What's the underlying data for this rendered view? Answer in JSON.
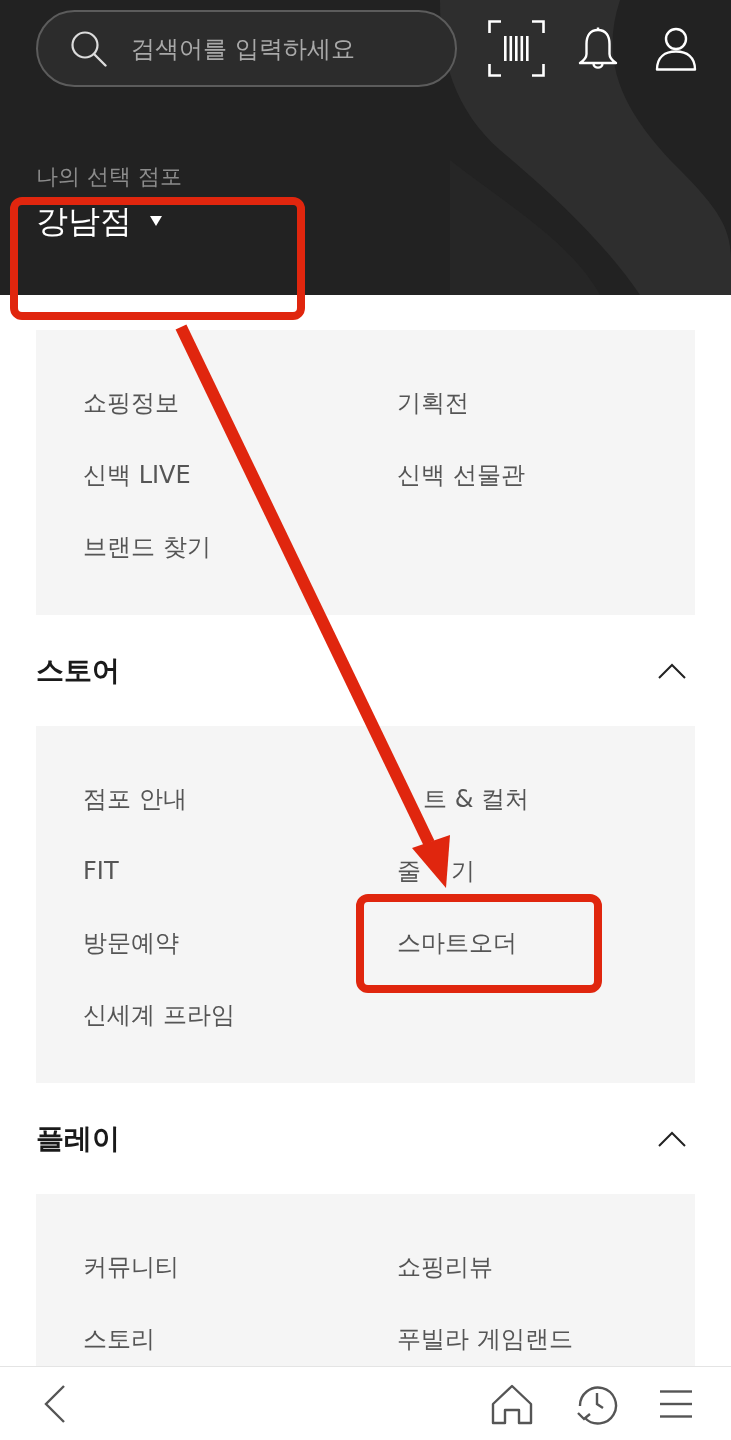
{
  "header": {
    "search": {
      "placeholder": "검색어를 입력하세요"
    },
    "store": {
      "caption": "나의 선택 점포",
      "name": "강남점",
      "highlighted": true
    }
  },
  "sections": [
    {
      "items": [
        {
          "kind": "whole",
          "label": "쇼핑정보",
          "highlighted": false
        },
        {
          "kind": "whole",
          "label": "기획전",
          "highlighted": false
        },
        {
          "kind": "whole",
          "label": "신백 LIVE",
          "highlighted": false
        },
        {
          "kind": "whole",
          "label": "신백 선물관",
          "highlighted": false
        },
        {
          "kind": "whole",
          "label": "브랜드 찾기",
          "highlighted": false
        }
      ]
    },
    {
      "title": "스토어",
      "expanded": true,
      "items": [
        {
          "kind": "whole",
          "label": "점포 안내",
          "highlighted": false
        },
        {
          "kind": "tail",
          "parts": [
            "트 & 컬처"
          ],
          "highlighted": false
        },
        {
          "kind": "whole",
          "label": "FIT",
          "highlighted": false
        },
        {
          "kind": "split",
          "parts": [
            "줄",
            "기"
          ],
          "highlighted": false
        },
        {
          "kind": "whole",
          "label": "방문예약",
          "highlighted": false
        },
        {
          "kind": "whole",
          "label": "스마트오더",
          "highlighted": true
        },
        {
          "kind": "whole",
          "label": "신세계 프라임",
          "highlighted": false
        }
      ]
    },
    {
      "title": "플레이",
      "expanded": true,
      "items": [
        {
          "kind": "whole",
          "label": "커뮤니티",
          "highlighted": false
        },
        {
          "kind": "whole",
          "label": "쇼핑리뷰",
          "highlighted": false
        },
        {
          "kind": "whole",
          "label": "스토리",
          "highlighted": false
        },
        {
          "kind": "whole",
          "label": "푸빌라 게임랜드",
          "highlighted": false
        }
      ]
    }
  ],
  "pointer_arrow": true
}
